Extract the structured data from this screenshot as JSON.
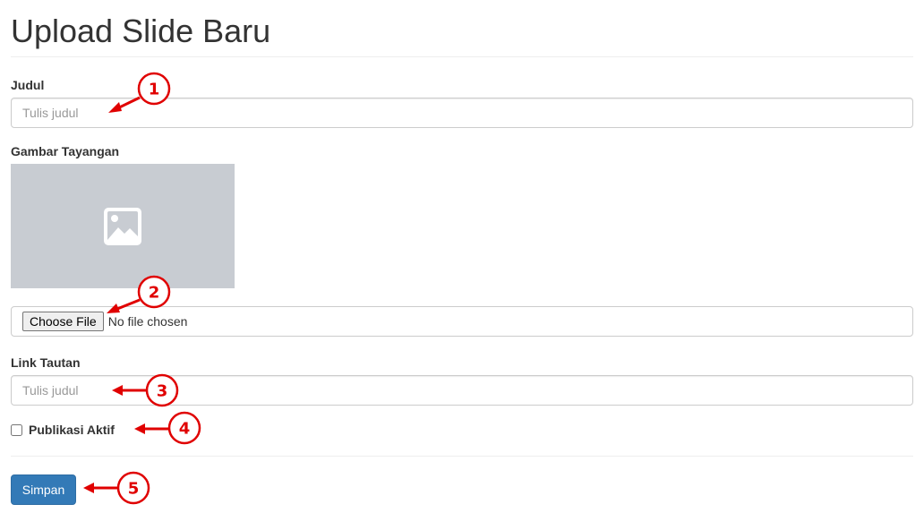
{
  "page": {
    "title": "Upload Slide Baru"
  },
  "form": {
    "judul": {
      "label": "Judul",
      "placeholder": "Tulis judul",
      "value": ""
    },
    "gambar": {
      "label": "Gambar Tayangan",
      "placeholder_icon": "image-icon",
      "choose_file_label": "Choose File",
      "file_status": "No file chosen"
    },
    "link": {
      "label": "Link Tautan",
      "placeholder": "Tulis judul",
      "value": ""
    },
    "publikasi": {
      "label": "Publikasi Aktif",
      "checked": false
    },
    "submit_label": "Simpan"
  },
  "annotations": [
    {
      "number": "1"
    },
    {
      "number": "2"
    },
    {
      "number": "3"
    },
    {
      "number": "4"
    },
    {
      "number": "5"
    }
  ],
  "colors": {
    "primary_button": "#337ab7",
    "annotation_red": "#e00000",
    "image_placeholder_bg": "#c8ccd2"
  }
}
